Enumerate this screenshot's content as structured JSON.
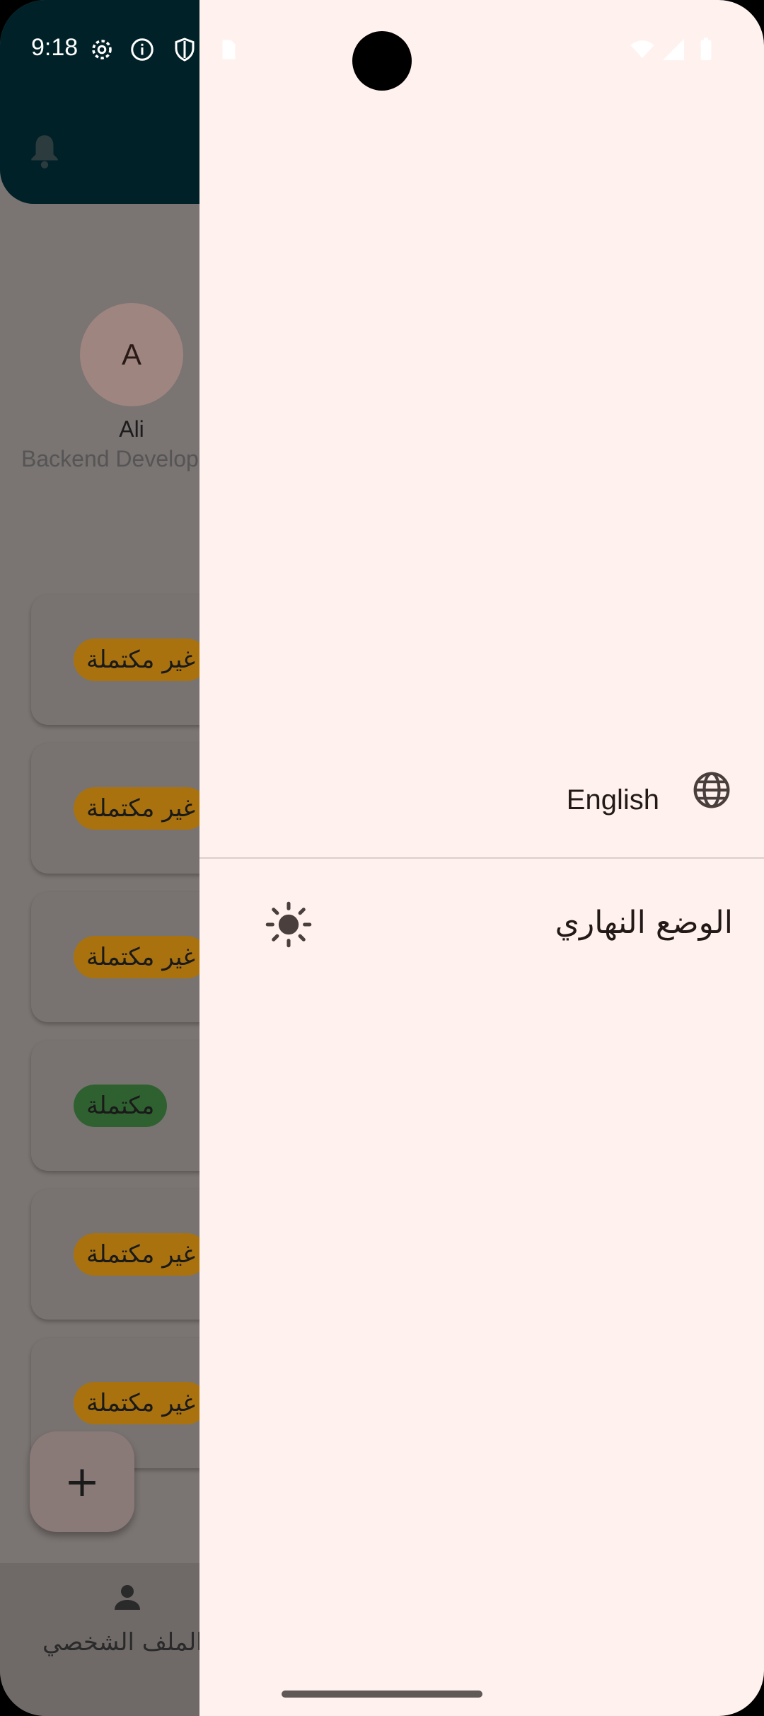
{
  "status_bar": {
    "time": "9:18"
  },
  "profile": {
    "avatar_initial": "A",
    "name": "Ali",
    "role": "Backend Developer"
  },
  "tasks": [
    {
      "status": "غير مكتملة",
      "color": "#b8750a"
    },
    {
      "status": "غير مكتملة",
      "color": "#b8750a"
    },
    {
      "status": "غير مكتملة",
      "color": "#b8750a"
    },
    {
      "status": "مكتملة",
      "color": "#2e6b34"
    },
    {
      "status": "غير مكتملة",
      "color": "#b8750a"
    },
    {
      "status": "غير مكتملة",
      "color": "#b8750a"
    }
  ],
  "fab": {
    "label": "+"
  },
  "bottom_nav": {
    "profile_label": "الملف الشخصي"
  },
  "drawer": {
    "language_label": "English",
    "theme_label": "الوضع النهاري"
  },
  "colors": {
    "header": "#002127",
    "drawer_bg": "#fff2ee",
    "scrim": "#7a7472"
  }
}
